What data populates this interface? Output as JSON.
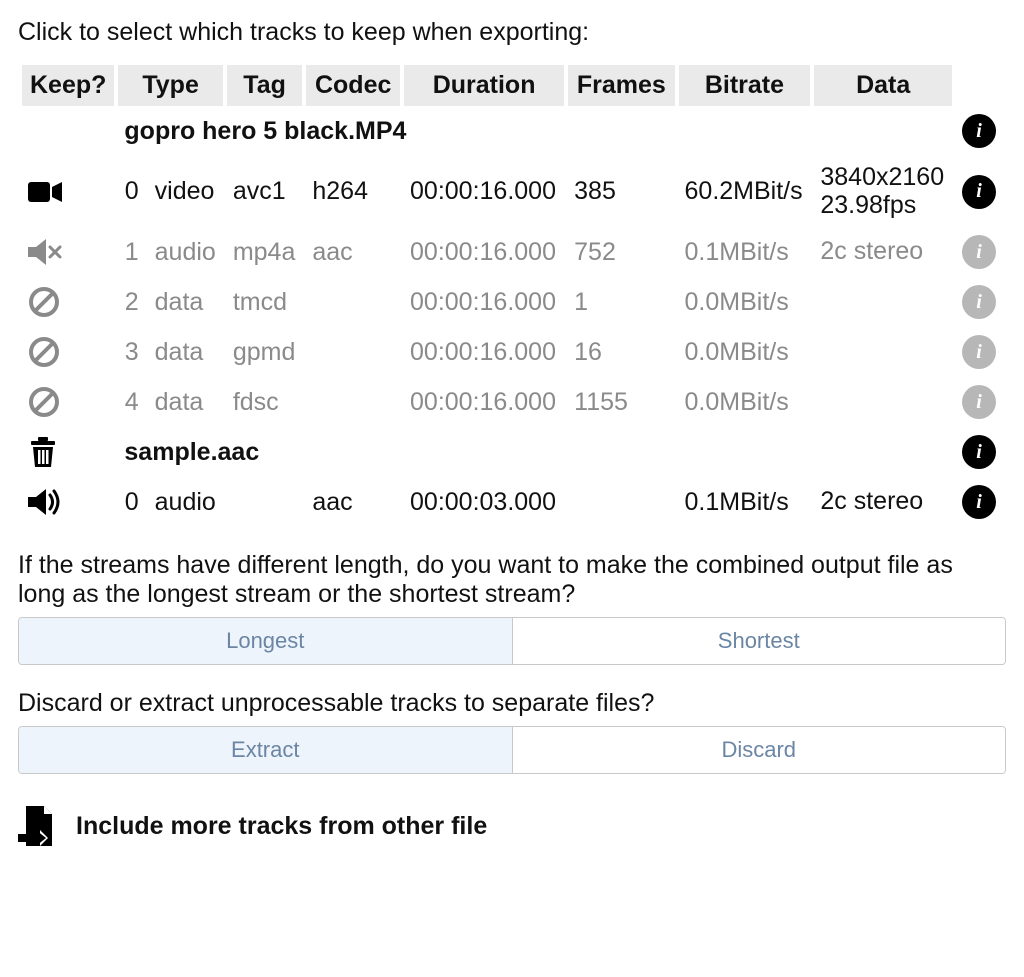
{
  "instruction": "Click to select which tracks to keep when exporting:",
  "columns": {
    "keep": "Keep?",
    "type": "Type",
    "tag": "Tag",
    "codec": "Codec",
    "duration": "Duration",
    "frames": "Frames",
    "bitrate": "Bitrate",
    "data": "Data"
  },
  "files": [
    {
      "name": "gopro hero 5 black.MP4",
      "file_icon": "",
      "tracks": [
        {
          "icon": "video",
          "enabled": true,
          "index": "0",
          "type": "video",
          "tag": "avc1",
          "codec": "h264",
          "duration": "00:00:16.000",
          "frames": "385",
          "bitrate": "60.2MBit/s",
          "data_line1": "3840x2160",
          "data_line2": "23.98fps"
        },
        {
          "icon": "audio-muted",
          "enabled": false,
          "index": "1",
          "type": "audio",
          "tag": "mp4a",
          "codec": "aac",
          "duration": "00:00:16.000",
          "frames": "752",
          "bitrate": "0.1MBit/s",
          "data_line1": "2c stereo",
          "data_line2": ""
        },
        {
          "icon": "ban",
          "enabled": false,
          "index": "2",
          "type": "data",
          "tag": "tmcd",
          "codec": "",
          "duration": "00:00:16.000",
          "frames": "1",
          "bitrate": "0.0MBit/s",
          "data_line1": "",
          "data_line2": ""
        },
        {
          "icon": "ban",
          "enabled": false,
          "index": "3",
          "type": "data",
          "tag": "gpmd",
          "codec": "",
          "duration": "00:00:16.000",
          "frames": "16",
          "bitrate": "0.0MBit/s",
          "data_line1": "",
          "data_line2": ""
        },
        {
          "icon": "ban",
          "enabled": false,
          "index": "4",
          "type": "data",
          "tag": "fdsc",
          "codec": "",
          "duration": "00:00:16.000",
          "frames": "1155",
          "bitrate": "0.0MBit/s",
          "data_line1": "",
          "data_line2": ""
        }
      ]
    },
    {
      "name": "sample.aac",
      "file_icon": "trash",
      "tracks": [
        {
          "icon": "audio",
          "enabled": true,
          "index": "0",
          "type": "audio",
          "tag": "",
          "codec": "aac",
          "duration": "00:00:03.000",
          "frames": "",
          "bitrate": "0.1MBit/s",
          "data_line1": "2c stereo",
          "data_line2": ""
        }
      ]
    }
  ],
  "length_question": "If the streams have different length, do you want to make the combined output file as long as the longest stream or the shortest stream?",
  "length_options": {
    "longest": "Longest",
    "shortest": "Shortest",
    "selected": "longest"
  },
  "discard_question": "Discard or extract unprocessable tracks to separate files?",
  "discard_options": {
    "extract": "Extract",
    "discard": "Discard",
    "selected": "extract"
  },
  "include_more": "Include more tracks from other file"
}
